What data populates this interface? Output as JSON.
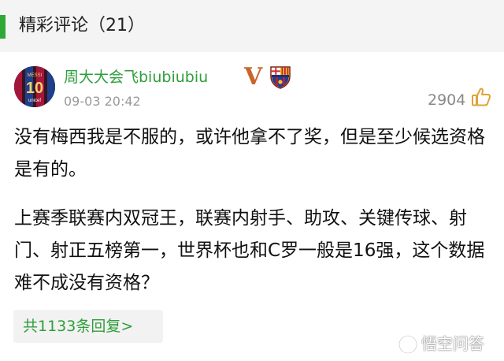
{
  "section": {
    "title": "精彩评论（21）",
    "accent_color": "#2fa836"
  },
  "comment": {
    "avatar": {
      "jersey_name": "MESSI",
      "jersey_number": "10",
      "sponsor": "unicef"
    },
    "username": "周大大会飞biubiubiu",
    "verified_badge": "V",
    "club_badge_icon": "barcelona-crest-icon",
    "timestamp": "09-03 20:42",
    "like_count": "2904",
    "like_icon": "thumbs-up-icon",
    "paragraphs": [
      "没有梅西我是不服的，或许他拿不了奖，但是至少候选资格是有的。",
      "上赛季联赛内双冠王，联赛内射手、助攻、关键传球、射门、射正五榜第一，世界杯也和C罗一般是16强，这个数据难不成没有资格？"
    ],
    "reply_link": "共1133条回复>",
    "username_color": "#2f9e3c"
  },
  "watermark": {
    "text": "悟空问答",
    "icon": "wukong-logo-icon"
  }
}
